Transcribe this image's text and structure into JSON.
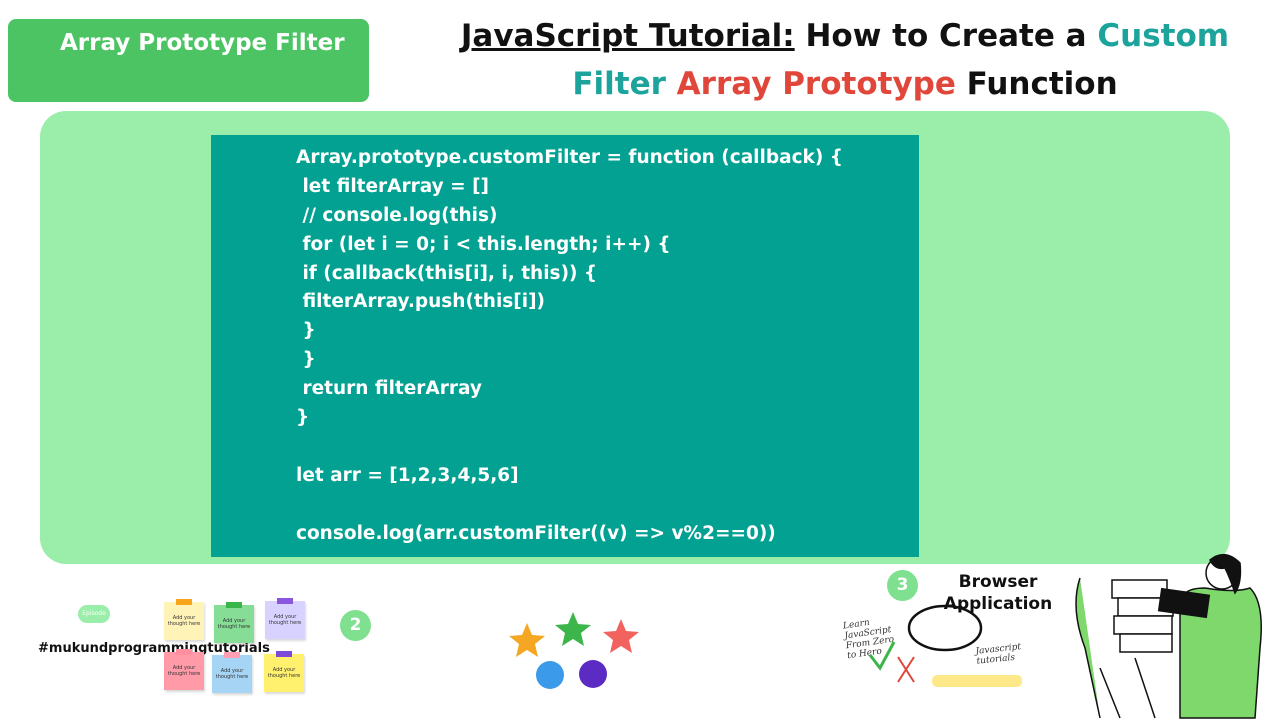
{
  "header": {
    "topic_label": "Array Prototype Filter",
    "title": {
      "part1": "JavaScript Tutorial:",
      "part2": " How to Create a ",
      "part3": "Custom Filter",
      "part4": " Array Prototype",
      "part5": " Function"
    }
  },
  "code": {
    "lines": [
      "Array.prototype.customFilter = function (callback) {",
      " let filterArray = []",
      " // console.log(this)",
      " for (let i = 0; i < this.length; i++) {",
      " if (callback(this[i], i, this)) {",
      " filterArray.push(this[i])",
      " }",
      " }",
      " return filterArray",
      "}",
      "",
      "let arr = [1,2,3,4,5,6]",
      "",
      "console.log(arr.customFilter((v) => v%2==0))"
    ]
  },
  "bottom": {
    "hashtag": "#mukundprogrammingtutorials",
    "pill_text": "Episode ###",
    "step2": "2",
    "step3": "3",
    "browser_label": "Browser Application",
    "handwritten_left": "Learn JavaScript From Zero to Hero",
    "handwritten_right": "Javascript tutorials",
    "sticky_notes": [
      {
        "text": "Add your thought here",
        "color": "#fff3b8",
        "tape": "#f7a61c"
      },
      {
        "text": "Add your thought here",
        "color": "#86dd95",
        "tape": "#39b54a"
      },
      {
        "text": "Add your thought here",
        "color": "#d7d2ff",
        "tape": "#8a56e0"
      },
      {
        "text": "Add your thought here",
        "color": "#ff9aa8",
        "tape": "#ff8fa0"
      },
      {
        "text": "Add your thought here",
        "color": "#a6d4f5",
        "tape": "#ff9fb3"
      },
      {
        "text": "Add your thought here",
        "color": "#fff06d",
        "tape": "#7d4bd6"
      }
    ],
    "colors": {
      "star_orange": "#f5a623",
      "star_green": "#3cb64a",
      "star_red": "#f2625e",
      "circle_blue": "#3b9bea",
      "circle_purple": "#5b2bc4",
      "person_green": "#7ed86b"
    }
  }
}
